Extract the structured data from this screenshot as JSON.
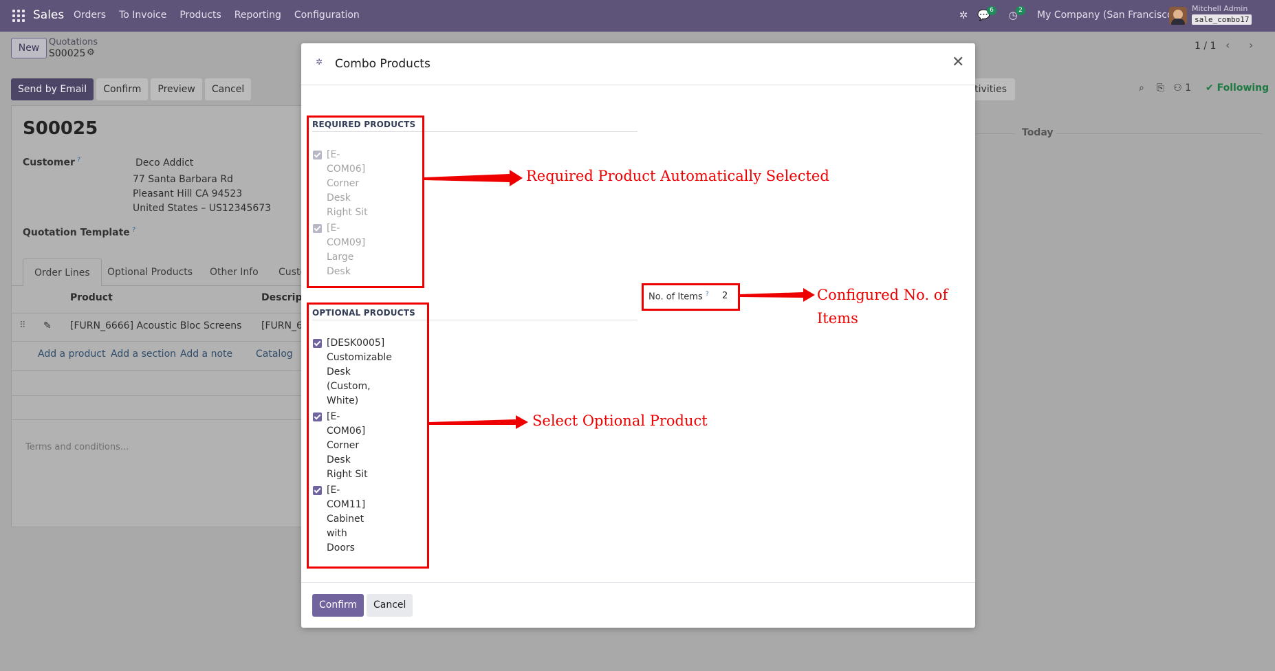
{
  "navbar": {
    "app_name": "Sales",
    "menu": [
      "Orders",
      "To Invoice",
      "Products",
      "Reporting",
      "Configuration"
    ],
    "messages_count": "6",
    "activities_count": "2",
    "company": "My Company (San Francisco)",
    "user_name": "Mitchell Admin",
    "database": "sale_combo17"
  },
  "control_panel": {
    "new_label": "New",
    "breadcrumb_parent": "Quotations",
    "breadcrumb_current": "S00025",
    "pager": "1 / 1",
    "actions": [
      "Send by Email",
      "Confirm",
      "Preview",
      "Cancel"
    ],
    "activities_label": "ctivities",
    "followers_count": "1",
    "following_label": "Following",
    "today_label": "Today"
  },
  "form": {
    "name": "S00025",
    "customer_label": "Customer",
    "customer_name": "Deco Addict",
    "address": [
      "77 Santa Barbara Rd",
      "Pleasant Hill CA 94523",
      "United States – US12345673"
    ],
    "template_label": "Quotation Template",
    "tabs": [
      "Order Lines",
      "Optional Products",
      "Other Info",
      "Custo"
    ],
    "columns": [
      "Product",
      "Descripti"
    ],
    "line_product": "[FURN_6666] Acoustic Bloc Screens",
    "line_description": "[FURN_6",
    "add_links": [
      "Add a product",
      "Add a section",
      "Add a note",
      "Catalog"
    ],
    "terms_placeholder": "Terms and conditions..."
  },
  "modal": {
    "title": "Combo Products",
    "required_heading": "REQUIRED PRODUCTS",
    "required_items": [
      {
        "lines": [
          "[E-",
          "COM06]",
          "Corner",
          "Desk",
          "Right Sit"
        ],
        "checked": true
      },
      {
        "lines": [
          "[E-",
          "COM09]",
          "Large",
          "Desk"
        ],
        "checked": true
      }
    ],
    "optional_heading": "OPTIONAL PRODUCTS",
    "optional_items": [
      {
        "lines": [
          "[DESK0005]",
          "Customizable",
          "Desk",
          "(Custom,",
          "White)"
        ],
        "checked": true
      },
      {
        "lines": [
          "[E-",
          "COM06]",
          "Corner",
          "Desk",
          "Right Sit"
        ],
        "checked": true
      },
      {
        "lines": [
          "[E-",
          "COM11]",
          "Cabinet",
          "with",
          "Doors"
        ],
        "checked": true
      }
    ],
    "items_label": "No. of Items",
    "items_value": "2",
    "confirm_label": "Confirm",
    "cancel_label": "Cancel"
  },
  "annotations": {
    "required_note": "Required Product Automatically Selected",
    "items_note_line1": "Configured No. of",
    "items_note_line2": "Items",
    "optional_note": "Select Optional Product",
    "color": "#ee0000"
  },
  "colors": {
    "navbar": "#5e5378",
    "primary": "#71639e",
    "following": "#1c7a41"
  }
}
